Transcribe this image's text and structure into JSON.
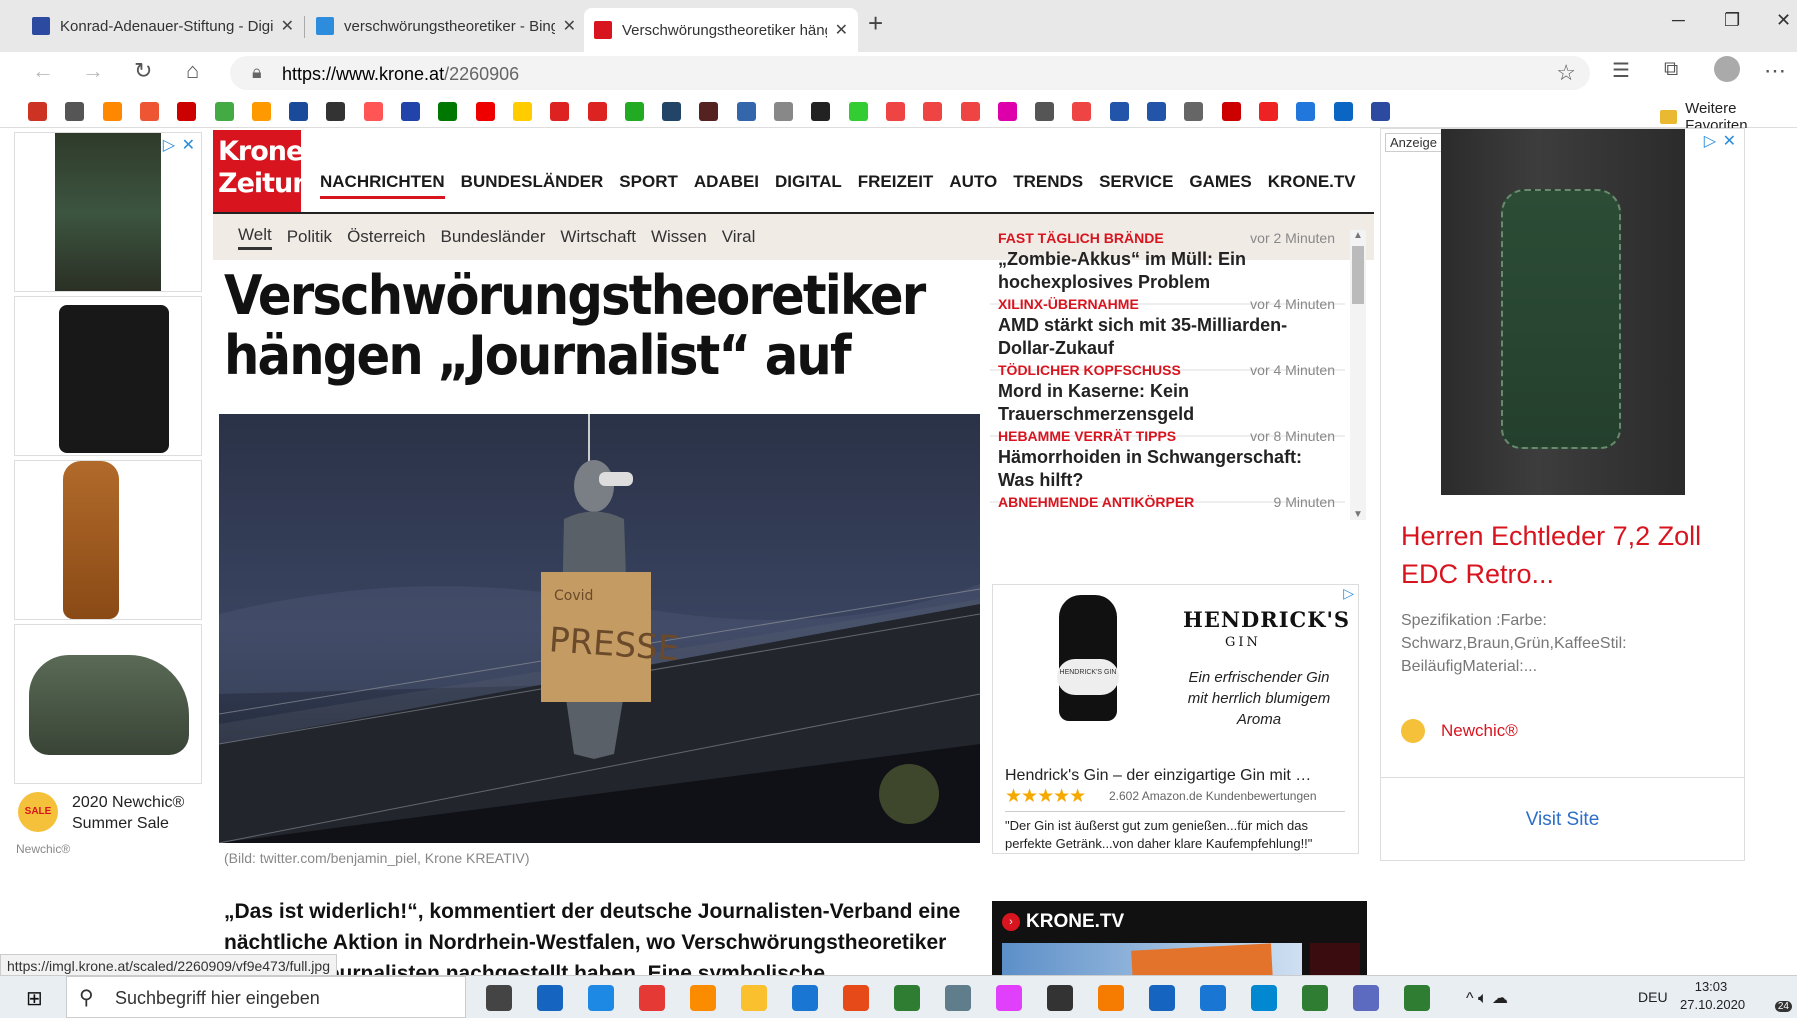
{
  "browser": {
    "tabs": [
      {
        "title": "Konrad-Adenauer-Stiftung - Digi",
        "color": "#2b4aa0"
      },
      {
        "title": "verschwörungstheoretiker - Bing",
        "color": "#2d8cdc"
      },
      {
        "title": "Verschwörungstheoretiker hänge",
        "color": "#d8141f"
      }
    ],
    "new_tab": "+",
    "url_host": "https://www.krone.at",
    "url_path": "/2260906",
    "more_favorites": "Weitere Favoriten"
  },
  "site": {
    "logo_line1": "Kronen",
    "logo_line2": "Zeitung",
    "main_nav": [
      "NACHRICHTEN",
      "BUNDESLÄNDER",
      "SPORT",
      "ADABEI",
      "DIGITAL",
      "FREIZEIT",
      "AUTO",
      "TRENDS",
      "SERVICE",
      "GAMES",
      "KRONE.TV"
    ],
    "sub_nav": [
      "Welt",
      "Politik",
      "Österreich",
      "Bundesländer",
      "Wirtschaft",
      "Wissen",
      "Viral"
    ]
  },
  "article": {
    "headline_line1": "Verschwörungstheoretiker",
    "headline_line2": "hängen „Journalist“ auf",
    "sign_small": "Covid",
    "sign_big": "PRESSE",
    "caption": "(Bild: twitter.com/benjamin_piel, Krone KREATIV)",
    "body_line1": "„Das ist widerlich!“, kommentiert der deutsche Journalisten-Verband eine",
    "body_line2": "nächtliche Aktion in Nordrhein-Westfalen, wo Verschwörungstheoretiker",
    "body_line3": "ng eines Journalisten nachgestellt haben. Eine symbolische"
  },
  "ticker": [
    {
      "cat": "FAST TÄGLICH BRÄNDE",
      "time": "vor 2 Minuten",
      "title": "„Zombie-Akkus“ im Müll: Ein hochexplosives Problem"
    },
    {
      "cat": "XILINX-ÜBERNAHME",
      "time": "vor 4 Minuten",
      "title": "AMD stärkt sich mit 35-Milliarden-Dollar-Zukauf"
    },
    {
      "cat": "TÖDLICHER KOPFSCHUSS",
      "time": "vor 4 Minuten",
      "title": "Mord in Kaserne: Kein Trauerschmerzensgeld"
    },
    {
      "cat": "HEBAMME VERRÄT TIPPS",
      "time": "vor 8 Minuten",
      "title": "Hämorrhoiden in Schwangerschaft: Was hilft?"
    },
    {
      "cat": "ABNEHMENDE ANTIKÖRPER",
      "time": "9 Minuten",
      "title": ""
    }
  ],
  "hendricks_ad": {
    "brand": "HENDRICK'S",
    "brand_sub": "GIN",
    "bottle_label": "HENDRICK'S GIN",
    "tagline": "Ein erfrischender Gin mit herrlich blumigem Aroma",
    "product": "Hendrick's Gin – der einzigartige Gin mit …",
    "stars": "★★★★★",
    "rating": 5,
    "reviews": "2.602 Amazon.de Kundenbewertungen",
    "quote": "\"Der Gin ist äußerst gut zum genießen...für mich das perfekte Getränk...von daher klare Kaufempfehlung!!\""
  },
  "krone_tv": {
    "label": "KRONE.TV"
  },
  "left_ad": {
    "title": "2020 Newchic® Summer Sale",
    "brand": "Newchic®",
    "badge": "SALE"
  },
  "right_ad": {
    "badge": "Anzeige",
    "title": "Herren Echtleder 7,2 Zoll EDC Retro...",
    "spec": "Spezifikation :Farbe: Schwarz,Braun,Grün,KaffeeStil: BeiläufigMaterial:...",
    "brand": "Newchic®",
    "cta": "Visit Site"
  },
  "status_url": "https://imgl.krone.at/scaled/2260909/vf9e473/full.jpg",
  "taskbar": {
    "search": "Suchbegriff hier eingeben",
    "lang": "DEU",
    "time": "13:03",
    "date": "27.10.2020",
    "notif": "24"
  }
}
